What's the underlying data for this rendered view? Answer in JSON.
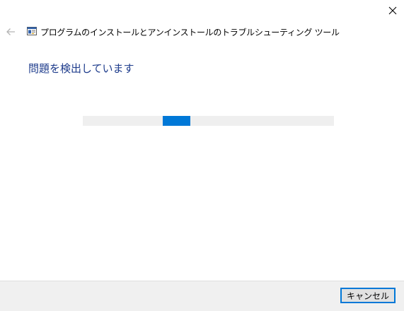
{
  "window": {
    "title": "プログラムのインストールとアンインストールのトラブルシューティング ツール"
  },
  "main": {
    "heading": "問題を検出しています",
    "progress": {
      "mode": "indeterminate",
      "chunk_fraction": 0.11,
      "chunk_offset_fraction": 0.317,
      "color": "#0078d7",
      "track_color": "#efefef"
    }
  },
  "footer": {
    "cancel_label": "キャンセル"
  },
  "colors": {
    "heading": "#1e3c8c",
    "accent": "#0078d7",
    "footer_bg": "#f0f0f0"
  },
  "icons": {
    "back": "back-arrow-icon",
    "close": "close-icon",
    "app": "troubleshooter-app-icon"
  }
}
